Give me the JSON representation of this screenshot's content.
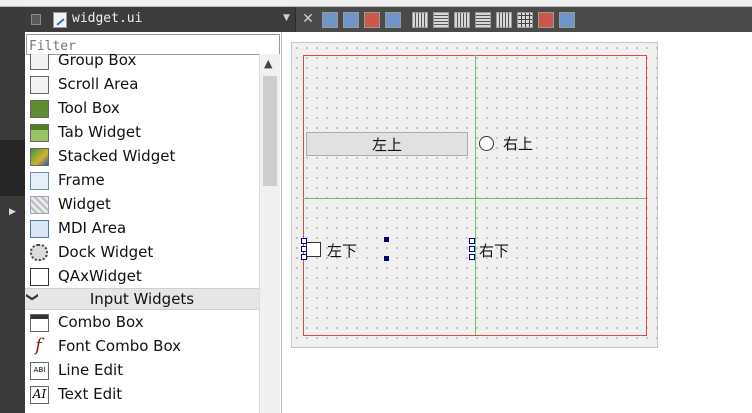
{
  "tab": {
    "title": "widget.ui",
    "dropdown_glyph": "▼",
    "close_glyph": "✕"
  },
  "widget_box": {
    "filter_placeholder": "Filter",
    "items": [
      {
        "label": "Group Box",
        "icon": "group-box-icon"
      },
      {
        "label": "Scroll Area",
        "icon": "scroll-area-icon"
      },
      {
        "label": "Tool Box",
        "icon": "tool-box-icon"
      },
      {
        "label": "Tab Widget",
        "icon": "tab-widget-icon"
      },
      {
        "label": "Stacked Widget",
        "icon": "stacked-widget-icon"
      },
      {
        "label": "Frame",
        "icon": "frame-icon"
      },
      {
        "label": "Widget",
        "icon": "widget-icon"
      },
      {
        "label": "MDI Area",
        "icon": "mdi-area-icon"
      },
      {
        "label": "Dock Widget",
        "icon": "dock-widget-icon"
      },
      {
        "label": "QAxWidget",
        "icon": "qaxwidget-icon"
      }
    ],
    "category": {
      "label": "Input Widgets",
      "chevron": "❯"
    },
    "input_items": [
      {
        "label": "Combo Box",
        "icon": "combo-box-icon"
      },
      {
        "label": "Font Combo Box",
        "icon": "font-combo-box-icon",
        "glyph": "f"
      },
      {
        "label": "Line Edit",
        "icon": "line-edit-icon",
        "glyph": "ABI"
      },
      {
        "label": "Text Edit",
        "icon": "text-edit-icon",
        "glyph": "AI"
      }
    ]
  },
  "form": {
    "push_button": "左上",
    "radio_label": "右上",
    "checkbox_label": "左下",
    "label_bottom_right": "右下"
  },
  "colors": {
    "layout_border": "#e04848",
    "layout_lines": "#6fc36f",
    "selection_handles": "#000080"
  }
}
